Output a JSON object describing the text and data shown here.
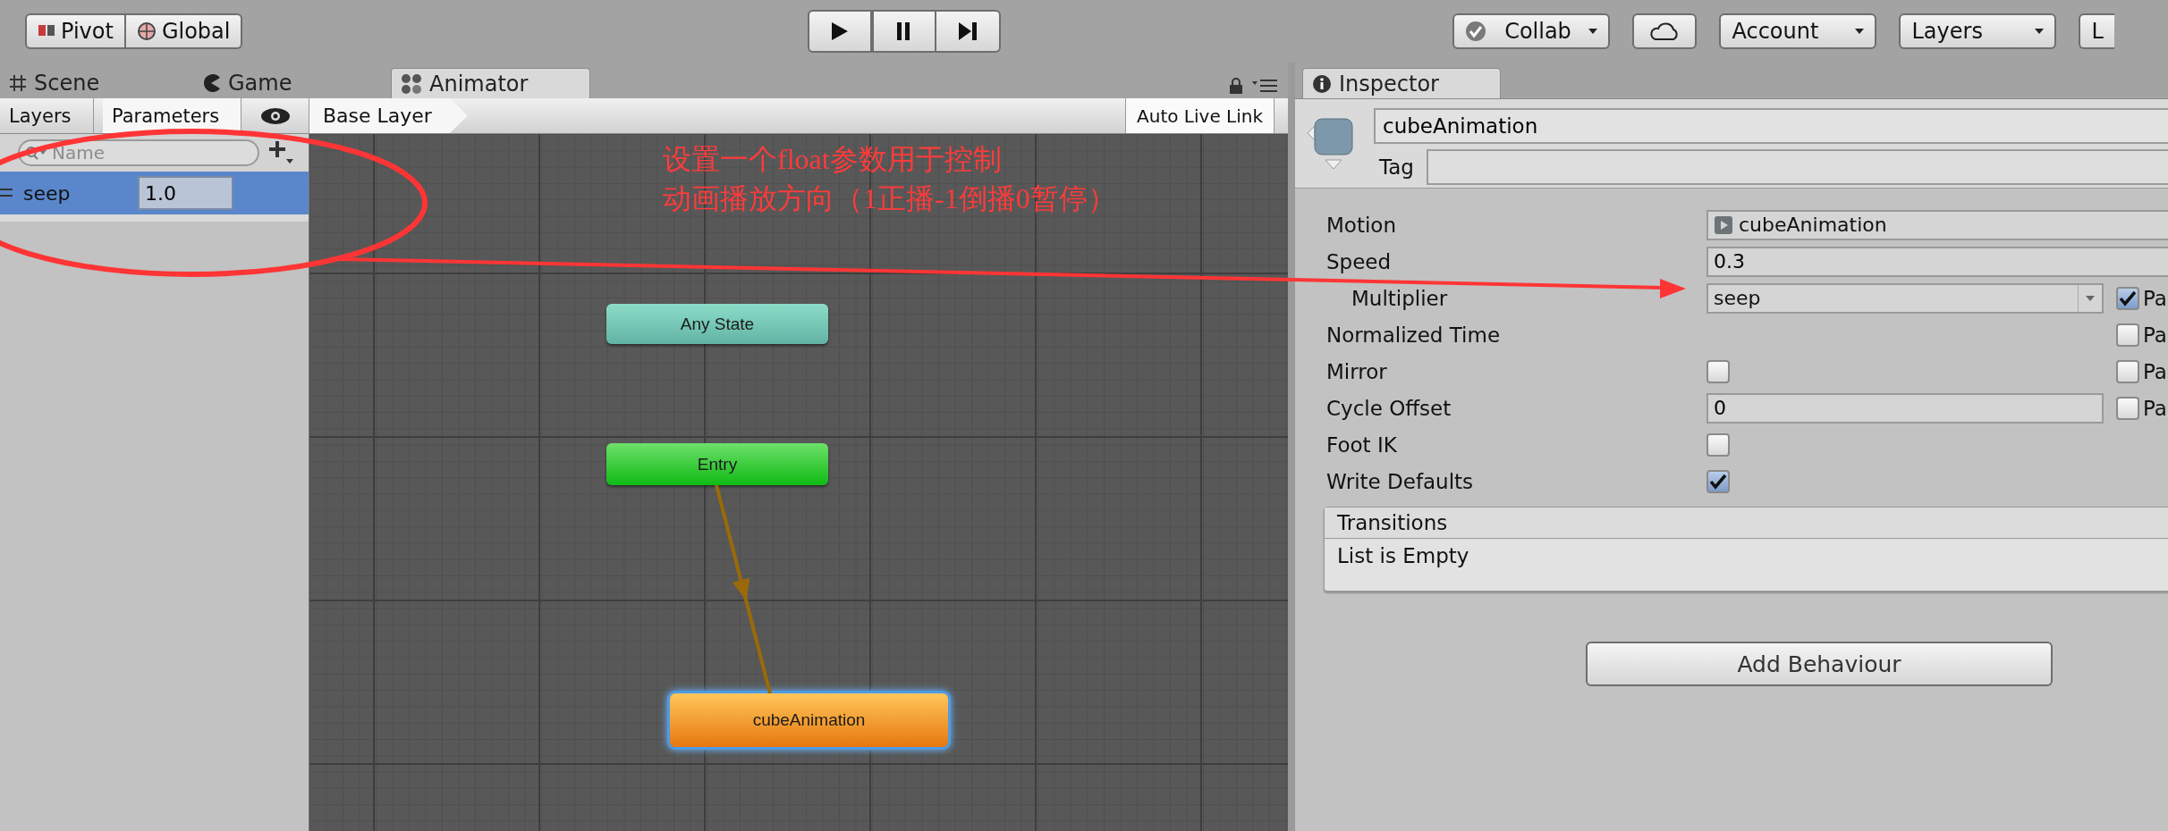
{
  "toolbar": {
    "handle_buttons": [
      {
        "label": "Pivot",
        "kind": "pivot"
      },
      {
        "label": "Global",
        "kind": "global"
      }
    ],
    "right_buttons": [
      {
        "label": "Collab",
        "kind": "collab"
      },
      {
        "kind": "cloud"
      },
      {
        "label": "Account",
        "kind": "dropdown"
      },
      {
        "label": "Layers",
        "kind": "dropdown"
      },
      {
        "label": "L",
        "kind": "cut"
      }
    ]
  },
  "tabs": [
    {
      "label": "Scene",
      "kind": "scene",
      "selected": false
    },
    {
      "label": "Game",
      "kind": "game",
      "selected": false
    },
    {
      "label": "Animator",
      "kind": "animator",
      "selected": true
    }
  ],
  "animator": {
    "panel_tabs": [
      {
        "label": "Layers",
        "selected": false
      },
      {
        "label": "Parameters",
        "selected": true
      }
    ],
    "search": {
      "placeholder": "Name"
    },
    "parameters": [
      {
        "name": "seep",
        "value": "1.0",
        "selected": true
      }
    ],
    "breadcrumb": "Base Layer",
    "auto_live_link": "Auto Live Link",
    "states": [
      {
        "name": "Any State",
        "kind": "any",
        "selected": false
      },
      {
        "name": "Entry",
        "kind": "entry",
        "selected": false
      },
      {
        "name": "cubeAnimation",
        "kind": "default",
        "selected": true
      }
    ]
  },
  "annotation": {
    "lines": [
      "设置一个float参数用于控制",
      "动画播放方向（1正播-1倒播0暂停）"
    ]
  },
  "inspector_tab": {
    "label": "Inspector"
  },
  "inspector": {
    "name": "cubeAnimation",
    "tag_label": "Tag",
    "fields": [
      {
        "label": "Motion",
        "kind": "object",
        "value": "cubeAnimation"
      },
      {
        "label": "Speed",
        "kind": "text",
        "value": "0.3",
        "children": [
          {
            "label": "Multiplier",
            "kind": "dropdown",
            "value": "seep",
            "parameter": {
              "label": "Pa",
              "checked": true
            }
          }
        ]
      },
      {
        "label": "Normalized Time",
        "kind": "blank",
        "parameter": {
          "label": "Pa",
          "checked": false
        }
      },
      {
        "label": "Mirror",
        "kind": "checkbox",
        "checked": false,
        "parameter": {
          "label": "Pa",
          "checked": false
        }
      },
      {
        "label": "Cycle Offset",
        "kind": "text",
        "value": "0",
        "parameter": {
          "label": "Pa",
          "checked": false
        }
      },
      {
        "label": "Foot IK",
        "kind": "checkbox",
        "checked": false
      },
      {
        "label": "Write Defaults",
        "kind": "checkbox",
        "checked": true
      }
    ],
    "transitions": {
      "title": "Transitions",
      "empty_text": "List is Empty"
    },
    "add_button": "Add Behaviour"
  }
}
